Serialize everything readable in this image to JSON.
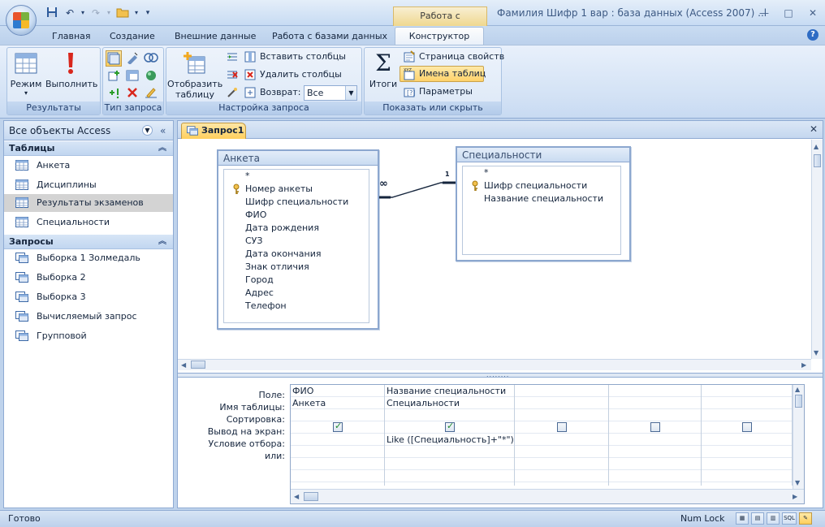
{
  "title_bar": {
    "window_title": "Фамилия Шифр 1 вар : база данных (Access 2007) ..l",
    "context_tool_title": "Работа с запросами",
    "minimize": "—",
    "maximize": "□",
    "close": "✕"
  },
  "tabs": [
    "Главная",
    "Создание",
    "Внешние данные",
    "Работа с базами данных",
    "Конструктор"
  ],
  "active_tab": "Конструктор",
  "ribbon": {
    "groups": {
      "results": {
        "label": "Результаты",
        "rezhim": "Режим",
        "vypolnit": "Выполнить"
      },
      "query_type": {
        "label": "Тип запроса"
      },
      "query_setup": {
        "label": "Настройка запроса",
        "show_table_line1": "Отобразить",
        "show_table_line2": "таблицу",
        "insert_columns": "Вставить столбцы",
        "delete_columns": "Удалить столбцы",
        "return_label": "Возврат:",
        "return_value": "Все"
      },
      "show_hide": {
        "label": "Показать или скрыть",
        "totals": "Итоги",
        "properties": "Страница свойств",
        "table_names": "Имена таблиц",
        "parameters": "Параметры"
      }
    }
  },
  "nav_pane": {
    "header": "Все объекты Access",
    "sections": [
      {
        "title": "Таблицы",
        "items": [
          "Анкета",
          "Дисциплины",
          "Результаты экзаменов",
          "Специальности"
        ]
      },
      {
        "title": "Запросы",
        "items": [
          "Выборка 1 Золмедаль",
          "Выборка 2",
          "Выборка 3",
          "Вычисляемый запрос",
          "Групповой"
        ]
      }
    ],
    "selected_item": "Результаты экзаменов"
  },
  "document": {
    "tab_label": "Запрос1",
    "tables": [
      {
        "name": "Анкета",
        "fields": [
          "*",
          "Номер анкеты",
          "Шифр специальности",
          "ФИО",
          "Дата рождения",
          "СУЗ",
          "Дата окончания",
          "Знак отличия",
          "Город",
          "Адрес",
          "Телефон"
        ],
        "key_field": "Номер анкеты"
      },
      {
        "name": "Специальности",
        "fields": [
          "*",
          "Шифр специальности",
          "Название специальности"
        ],
        "key_field": "Шифр специальности"
      }
    ],
    "relationship": {
      "one_label": "1",
      "many_label": "∞"
    },
    "grid": {
      "row_labels": [
        "Поле:",
        "Имя таблицы:",
        "Сортировка:",
        "Вывод на экран:",
        "Условие отбора:",
        "или:"
      ],
      "columns": [
        {
          "field": "ФИО",
          "table": "Анкета",
          "sort": "",
          "show": true,
          "criteria": ""
        },
        {
          "field": "Название специальности",
          "table": "Специальности",
          "sort": "",
          "show": true,
          "criteria": "Like ([Специальность]+\"*\")"
        },
        {
          "field": "",
          "table": "",
          "sort": "",
          "show": false,
          "criteria": ""
        },
        {
          "field": "",
          "table": "",
          "sort": "",
          "show": false,
          "criteria": ""
        },
        {
          "field": "",
          "table": "",
          "sort": "",
          "show": false,
          "criteria": ""
        }
      ]
    }
  },
  "status_bar": {
    "status": "Готово",
    "numlock": "Num Lock",
    "sql_label": "SQL"
  },
  "colors": {
    "accent": "#ffd26a",
    "frame": "#bfd3ec"
  }
}
